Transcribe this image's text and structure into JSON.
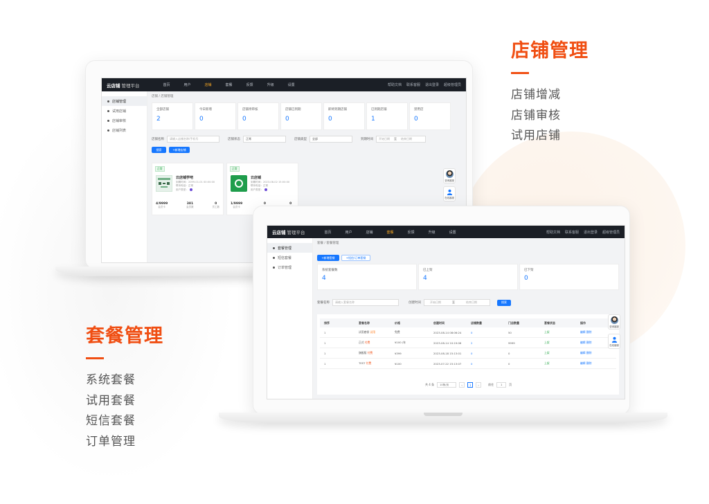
{
  "features": {
    "store": {
      "title": "店铺管理",
      "items": [
        "店铺增减",
        "店铺审核",
        "试用店铺"
      ]
    },
    "plan": {
      "title": "套餐管理",
      "items": [
        "系统套餐",
        "试用套餐",
        "短信套餐",
        "订单管理"
      ]
    }
  },
  "app": {
    "logo": "云店铺",
    "logo_sub": "管理平台",
    "nav": [
      "首页",
      "用户",
      "店铺",
      "套餐",
      "反馈",
      "升级",
      "设置"
    ],
    "nav_right": [
      "帮助文档",
      "联系客服",
      "退出登录",
      "超级管理员"
    ],
    "float_labels": [
      "咨询客服",
      "在线客服"
    ]
  },
  "screen1": {
    "sidebar": [
      "店铺管理",
      "试用店铺",
      "店铺审核",
      "店铺列表"
    ],
    "breadcrumb": "店铺 / 店铺管理",
    "stats": [
      {
        "label": "全部店铺",
        "value": "2"
      },
      {
        "label": "今日新增",
        "value": "0"
      },
      {
        "label": "店铺待审核",
        "value": "0"
      },
      {
        "label": "店铺已到期",
        "value": "0"
      },
      {
        "label": "即将到期店铺",
        "value": "0"
      },
      {
        "label": "已到期店铺",
        "value": "1"
      },
      {
        "label": "禁用店",
        "value": "0"
      }
    ],
    "filters": {
      "name_label": "店铺名称",
      "name_placeholder": "请输入店铺名称/手机号",
      "status_label": "店铺状态",
      "status_value": "正常",
      "type_label": "店铺类型",
      "type_value": "全部",
      "time_label": "到期时间",
      "time_start": "开始日期",
      "time_end": "结束日期",
      "time_sep": "至"
    },
    "buttons": {
      "search": "搜索",
      "add": "+新增店铺"
    },
    "cards": [
      {
        "tag": "正常",
        "name": "云店铺学吧",
        "meta": [
          "到期时间：2099-01-01 00:00:00",
          "联系电话：正常",
          "用户类型："
        ],
        "stats": [
          {
            "v": "4/9999",
            "l": "会员卡"
          },
          {
            "v": "381",
            "l": "会员数"
          },
          {
            "v": "0",
            "l": "员工数"
          }
        ]
      },
      {
        "tag": "正常",
        "name": "云店铺",
        "meta": [
          "到期时间：2023-08-02 15:00:00",
          "联系电话：正常",
          "用户类型："
        ],
        "stats": [
          {
            "v": "1/9999",
            "l": "会员卡"
          },
          {
            "v": "0",
            "l": "会员数"
          },
          {
            "v": "0",
            "l": "员工数"
          }
        ]
      }
    ]
  },
  "screen2": {
    "sidebar": [
      "套餐管理",
      "短信套餐",
      "订单管理"
    ],
    "breadcrumb": "套餐 / 套餐管理",
    "tabs": [
      "+新增套餐",
      "+短信/订单套餐"
    ],
    "stats": [
      {
        "label": "系统套餐数",
        "value": "4"
      },
      {
        "label": "已上架",
        "value": "4"
      },
      {
        "label": "已下架",
        "value": "0"
      }
    ],
    "filters": {
      "name_label": "套餐名称",
      "name_placeholder": "请输入套餐名称",
      "time_label": "创建时间",
      "time_start": "开始日期",
      "time_end": "结束日期",
      "time_sep": "至",
      "search": "搜索"
    },
    "columns": [
      "排序",
      "套餐名称",
      "价格",
      "创建时间",
      "店铺数量",
      "门店数量",
      "套餐状态",
      "操作"
    ],
    "rows": [
      {
        "sort": "1",
        "name": "试用套餐",
        "badge": "试用",
        "badge_type": "o",
        "price": "免费",
        "time": "2023-08-14 08:06:24",
        "stores": "0",
        "shops": "50",
        "status": "上架",
        "ops": [
          "编辑",
          "删除"
        ]
      },
      {
        "sort": "1",
        "name": "正式",
        "badge": "付费",
        "badge_type": "r",
        "price": "¥100 /年",
        "time": "2023-08-14 10:19:06",
        "stores": "2",
        "shops": "9999",
        "status": "上架",
        "ops": [
          "编辑",
          "删除"
        ]
      },
      {
        "sort": "1",
        "name": "旗舰版",
        "badge": "付费",
        "badge_type": "r",
        "price": "¥399",
        "time": "2023-08-18 15:13:01",
        "stores": "0",
        "shops": "0",
        "status": "上架",
        "ops": [
          "编辑",
          "删除"
        ]
      },
      {
        "sort": "1",
        "name": "TEST",
        "badge": "付费",
        "badge_type": "r",
        "price": "¥100",
        "time": "2023-07-22 15:13:07",
        "stores": "0",
        "shops": "0",
        "status": "上架",
        "ops": [
          "编辑",
          "删除"
        ]
      }
    ],
    "pager": {
      "total": "共 4 条",
      "size": "10条/页",
      "page": "1",
      "goto": "前往",
      "goto_val": "1",
      "suffix": "页"
    }
  }
}
